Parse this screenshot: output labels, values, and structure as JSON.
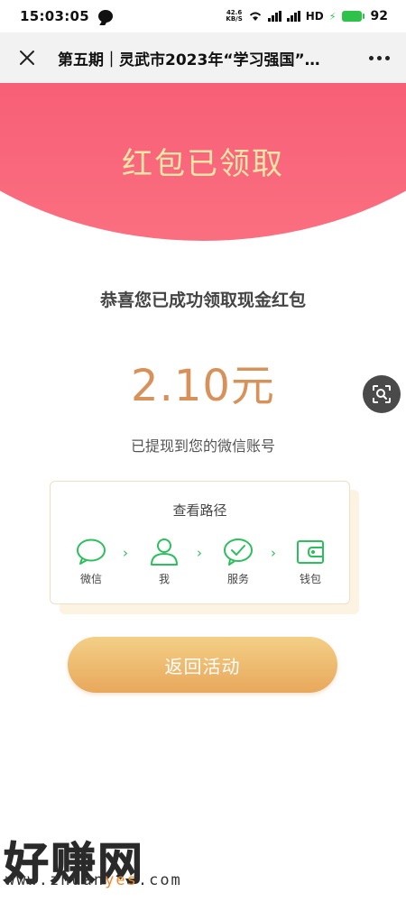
{
  "status_bar": {
    "time": "15:03:05",
    "net_speed_top": "42.6",
    "net_speed_bottom": "KB/S",
    "network_badge": "HD",
    "battery_level": "92"
  },
  "nav": {
    "title": "第五期｜灵武市2023年“学习强国”…",
    "close_icon": "close-icon",
    "more_icon": "more-icon"
  },
  "hero": {
    "title": "红包已领取"
  },
  "result": {
    "congrats": "恭喜您已成功领取现金红包",
    "amount": "2.10元",
    "withdrawn": "已提现到您的微信账号"
  },
  "path_card": {
    "title": "查看路径",
    "steps": [
      {
        "label": "微信",
        "icon": "chat-bubble-icon"
      },
      {
        "label": "我",
        "icon": "user-icon"
      },
      {
        "label": "服务",
        "icon": "check-circle-icon"
      },
      {
        "label": "钱包",
        "icon": "wallet-icon"
      }
    ]
  },
  "actions": {
    "back_label": "返回活动"
  },
  "watermark": {
    "brand": "好赚网",
    "url_prefix": "www.zhuan",
    "url_highlight": "yes",
    "url_suffix": ".com"
  },
  "colors": {
    "hero": "#f65170",
    "hero_text": "#fbe6a8",
    "amount": "#d9915a",
    "path_green": "#2dbf5d",
    "button_top": "#f3cf86",
    "button_bottom": "#e8a85c"
  }
}
